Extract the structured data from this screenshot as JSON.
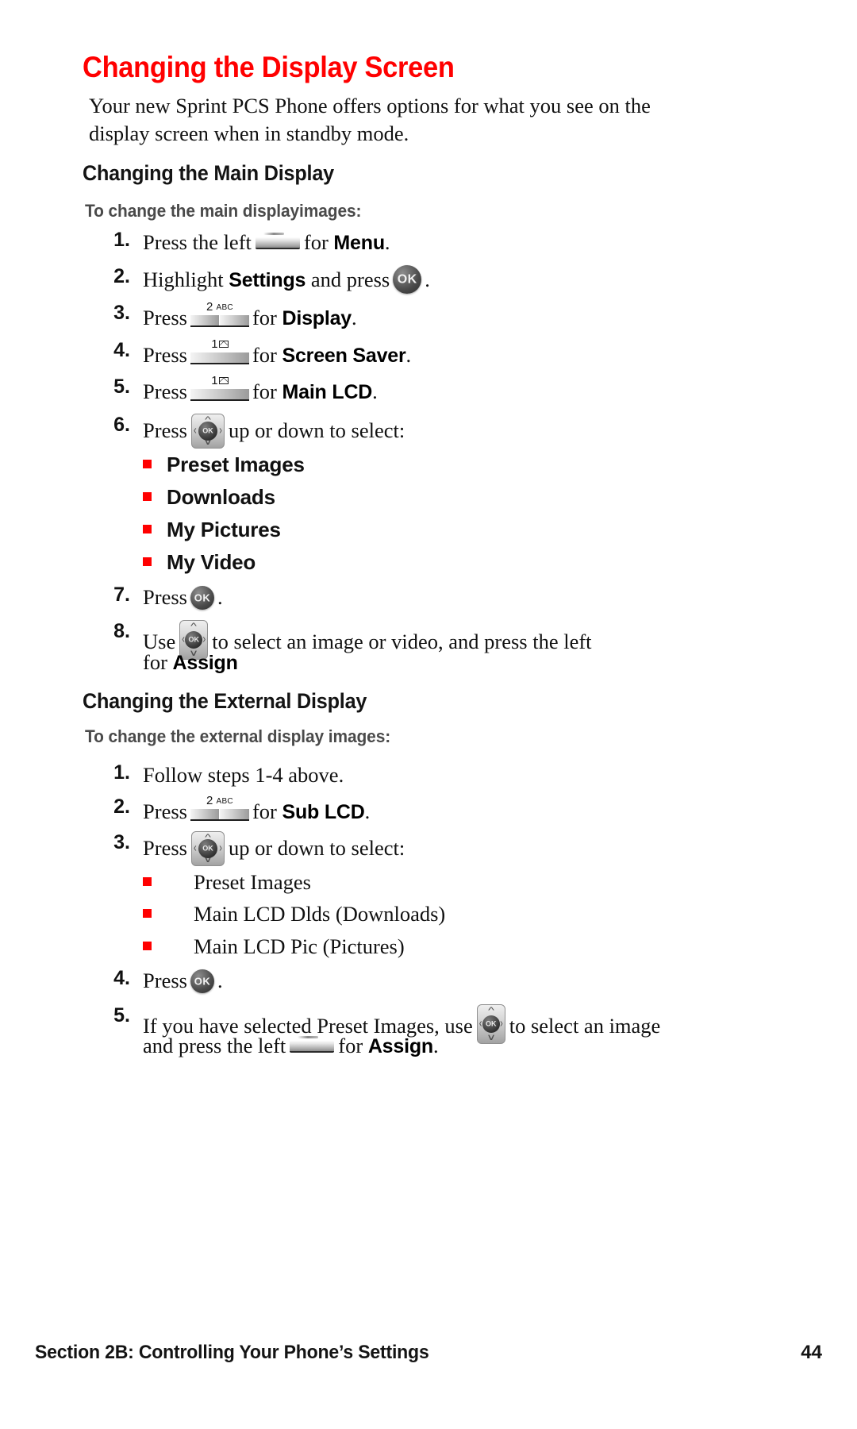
{
  "document": {
    "title": "Changing the Display Screen",
    "title_color": "#ff0000",
    "bullet_color": "#ff0000",
    "intro": "Your new Sprint PCS Phone offers options for what you see on the display screen when in standby mode."
  },
  "sections": [
    {
      "heading": "Changing the Main Display",
      "subheading": "To change the main displayimages:",
      "steps": [
        {
          "number": "1.",
          "text_before": "Press the left",
          "icon": "softkey-icon",
          "text_after": "for",
          "emphasis": "Menu",
          "text_end": "."
        },
        {
          "number": "2.",
          "text_before": "Highlight",
          "emphasis": "Settings",
          "text_mid": "and press",
          "icon": "ok-button-icon",
          "text_end": "."
        },
        {
          "number": "3.",
          "text_before": "Press",
          "icon": "key-2-icon",
          "key_label": "2",
          "key_sublabel": "ABC",
          "text_after": "for",
          "emphasis": "Display",
          "text_end": "."
        },
        {
          "number": "4.",
          "text_before": "Press",
          "icon": "key-1-icon",
          "key_label": "1",
          "key_sublabel": "envelope",
          "text_after": "for",
          "emphasis": "Screen Saver",
          "text_end": "."
        },
        {
          "number": "5.",
          "text_before": "Press",
          "icon": "key-1-icon",
          "key_label": "1",
          "key_sublabel": "envelope",
          "text_after": "for",
          "emphasis": "Main LCD",
          "text_end": "."
        },
        {
          "number": "6.",
          "text_before": "Press",
          "icon": "navigation-pad-icon",
          "text_after": "up or down to select:"
        },
        {
          "number": "7.",
          "text_before": "Press",
          "icon": "ok-button-icon",
          "text_end": "."
        },
        {
          "number": "8.",
          "text_before": "Use",
          "icon": "navigation-pad-icon",
          "text_after": "to select an image or video, and press the left",
          "text_line2": "for",
          "emphasis": "Assign"
        }
      ],
      "bullets": [
        "Preset Images",
        "Downloads",
        "My Pictures",
        "My Video"
      ],
      "bullet_style": "bold-sans"
    },
    {
      "heading": "Changing the External Display",
      "subheading": "To change the external display images:",
      "steps": [
        {
          "number": "1.",
          "text_before": "Follow steps 1-4 above."
        },
        {
          "number": "2.",
          "text_before": "Press",
          "icon": "key-2-icon",
          "key_label": "2",
          "key_sublabel": "ABC",
          "text_after": "for",
          "emphasis": "Sub LCD",
          "text_end": "."
        },
        {
          "number": "3.",
          "text_before": "Press",
          "icon": "navigation-pad-icon",
          "text_after": "up or down to select:"
        },
        {
          "number": "4.",
          "text_before": "Press",
          "icon": "ok-button-icon",
          "text_end": "."
        },
        {
          "number": "5.",
          "text_before": "If you have selected Preset Images, use",
          "icon": "navigation-pad-icon",
          "text_after": "to select an image",
          "text_line2_before": "and press the left",
          "text_line2_after": "for",
          "emphasis": "Assign",
          "text_end": "."
        }
      ],
      "bullets": [
        "Preset Images",
        "Main LCD Dlds (Downloads)",
        "Main LCD Pic (Pictures)"
      ],
      "bullet_style": "serif"
    }
  ],
  "footer": {
    "section_label": "Section 2B: Controlling Your Phone’s Settings",
    "page_number": "44"
  }
}
